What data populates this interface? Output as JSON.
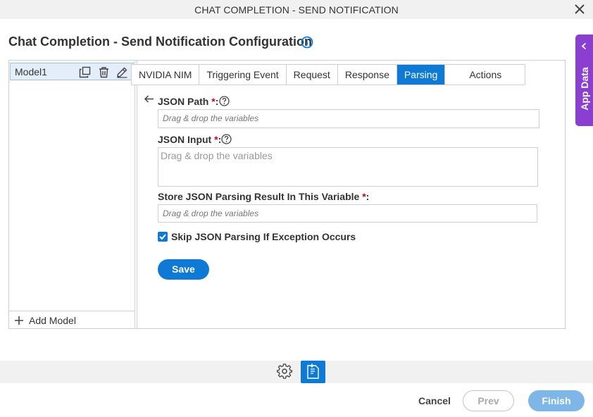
{
  "window": {
    "title": "CHAT COMPLETION - SEND NOTIFICATION",
    "close_icon": "close-icon"
  },
  "page": {
    "title": "Chat Completion - Send Notification Configuration",
    "info_icon": "info-icon"
  },
  "app_data": {
    "label": "App Data",
    "icon": "chevron-left-icon",
    "color": "#8a3fd1"
  },
  "models": {
    "items": [
      {
        "name": "Model1",
        "selected": true
      }
    ],
    "item_icons": [
      "copy-icon",
      "trash-icon",
      "pencil-icon"
    ],
    "add_label": "Add Model"
  },
  "tabs": [
    {
      "label": "NVIDIA NIM",
      "active": false
    },
    {
      "label": "Triggering Event",
      "active": false
    },
    {
      "label": "Request",
      "active": false
    },
    {
      "label": "Response",
      "active": false
    },
    {
      "label": "Parsing",
      "active": true
    },
    {
      "label": "Actions",
      "active": false
    }
  ],
  "form": {
    "json_path": {
      "label": "JSON Path",
      "required_mark": "*",
      "colon": ":",
      "placeholder": "Drag & drop the variables",
      "value": ""
    },
    "json_input": {
      "label": "JSON Input",
      "required_mark": "*",
      "colon": ":",
      "placeholder": "Drag & drop the variables",
      "value": ""
    },
    "store_result": {
      "label": "Store JSON Parsing Result In This Variable",
      "required_mark": "*",
      "colon": ":",
      "placeholder": "Drag & drop the variables",
      "value": ""
    },
    "skip_on_exception": {
      "label": "Skip JSON Parsing If Exception Occurs",
      "checked": true
    },
    "save_label": "Save"
  },
  "toolbar": {
    "icons": [
      "gear-icon",
      "document-icon"
    ]
  },
  "footer": {
    "cancel_label": "Cancel",
    "prev_label": "Prev",
    "finish_label": "Finish"
  },
  "colors": {
    "accent": "#0f7ad6",
    "required": "#d0021b",
    "finish_disabled": "#7fb6e8"
  }
}
